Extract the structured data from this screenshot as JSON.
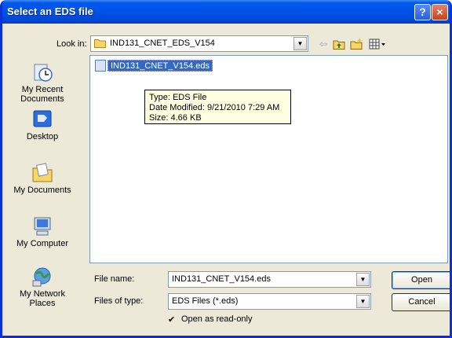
{
  "window": {
    "title": "Select an EDS file",
    "help_button": "?",
    "close_button": "×"
  },
  "toolbar": {
    "lookin_label": "Look in:",
    "lookin_value": "IND131_CNET_EDS_V154",
    "back_icon": "back-arrow",
    "up_folder_icon": "up-one-level",
    "new_folder_icon": "create-new-folder",
    "view_menu_icon": "view-menu"
  },
  "places": [
    {
      "label_line1": "My Recent",
      "label_line2": "Documents",
      "icon": "recent-documents"
    },
    {
      "label_line1": "Desktop",
      "label_line2": "",
      "icon": "desktop"
    },
    {
      "label_line1": "My Documents",
      "label_line2": "",
      "icon": "my-documents"
    },
    {
      "label_line1": "My Computer",
      "label_line2": "",
      "icon": "my-computer"
    },
    {
      "label_line1": "My Network",
      "label_line2": "Places",
      "icon": "network-places"
    }
  ],
  "files": [
    {
      "name": "IND131_CNET_V154.eds",
      "selected": true
    }
  ],
  "tooltip": {
    "line1": "Type: EDS File",
    "line2": "Date Modified: 9/21/2010 7:29 AM",
    "line3": "Size: 4.66 KB"
  },
  "form": {
    "filename_label": "File name:",
    "filename_value": "IND131_CNET_V154.eds",
    "filetype_label": "Files of type:",
    "filetype_value": "EDS Files (*.eds)",
    "readonly_label": "Open as read-only",
    "readonly_checked": true
  },
  "buttons": {
    "open": "Open",
    "cancel": "Cancel"
  },
  "colors": {
    "titlebar": "#0054e3",
    "selection": "#316ac5",
    "tooltip_bg": "#ffffe1",
    "dialog_bg": "#ece9d8"
  }
}
